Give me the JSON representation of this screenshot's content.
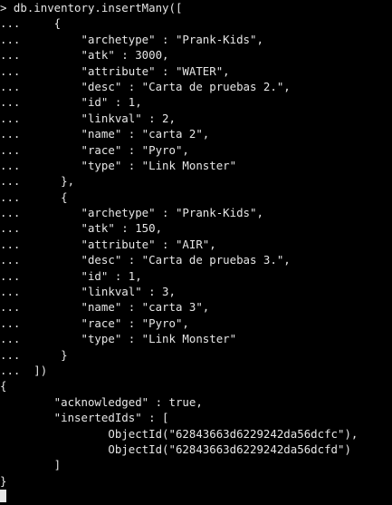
{
  "colors": {
    "background": "#000000",
    "foreground": "#e6e6e6"
  },
  "terminal": {
    "lines": [
      "> db.inventory.insertMany([",
      "...     {",
      "...         \"archetype\" : \"Prank-Kids\",",
      "...         \"atk\" : 3000,",
      "...         \"attribute\" : \"WATER\",",
      "...         \"desc\" : \"Carta de pruebas 2.\",",
      "...         \"id\" : 1,",
      "...         \"linkval\" : 2,",
      "...         \"name\" : \"carta 2\",",
      "...         \"race\" : \"Pyro\",",
      "...         \"type\" : \"Link Monster\"",
      "...      },",
      "...      {",
      "...         \"archetype\" : \"Prank-Kids\",",
      "...         \"atk\" : 150,",
      "...         \"attribute\" : \"AIR\",",
      "...         \"desc\" : \"Carta de pruebas 3.\",",
      "...         \"id\" : 1,",
      "...         \"linkval\" : 3,",
      "...         \"name\" : \"carta 3\",",
      "...         \"race\" : \"Pyro\",",
      "...         \"type\" : \"Link Monster\"",
      "...      }",
      "...  ])",
      "{",
      "        \"acknowledged\" : true,",
      "        \"insertedIds\" : [",
      "                ObjectId(\"62843663d6229242da56dcfc\"),",
      "                ObjectId(\"62843663d6229242da56dcfd\")",
      "        ]",
      "}"
    ]
  }
}
